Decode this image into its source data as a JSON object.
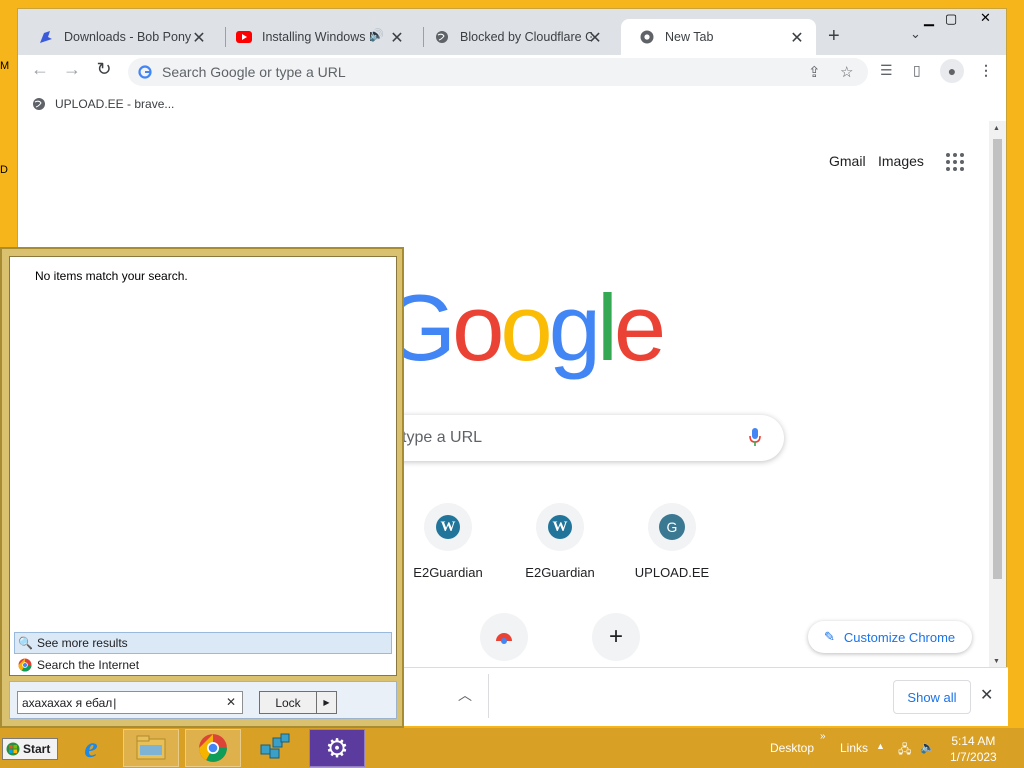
{
  "desktop": {
    "edge_letters": [
      "M",
      "D"
    ]
  },
  "chrome": {
    "tabs": [
      {
        "title": "Downloads - Bob Pony",
        "icon": "bob-pony-favicon-icon"
      },
      {
        "title": "Installing Windows M",
        "icon": "youtube-icon",
        "audio": "speaker-icon"
      },
      {
        "title": "Blocked by Cloudflare Ga",
        "icon": "globe-icon"
      },
      {
        "title": "New Tab",
        "icon": "chrome-icon"
      }
    ],
    "omnibox": {
      "placeholder": "Search Google or type a URL"
    },
    "bookmarks": [
      {
        "label": "UPLOAD.EE - brave..."
      }
    ],
    "ntp": {
      "links": {
        "gmail": "Gmail",
        "images": "Images"
      },
      "logo": "Google",
      "search_placeholder_visible": "type a URL",
      "shortcuts": [
        {
          "label": "E2Guardian",
          "icon": "wordpress-icon"
        },
        {
          "label": "E2Guardian",
          "icon": "wordpress-icon"
        },
        {
          "label": "UPLOAD.EE",
          "icon": "g-avatar-icon",
          "letter": "G"
        }
      ],
      "customize_label": "Customize Chrome"
    },
    "download_bar": {
      "show_all": "Show all"
    }
  },
  "start_menu": {
    "no_items": "No items match your search.",
    "see_more": "See more results",
    "search_internet": "Search the Internet",
    "search_value": "ахахахах я ебал",
    "lock_label": "Lock"
  },
  "taskbar": {
    "start_label": "Start",
    "desktop_label": "Desktop",
    "links_label": "Links",
    "time": "5:14 AM",
    "date": "1/7/2023"
  },
  "colors": {
    "google_blue": "#4285f4",
    "google_red": "#ea4335",
    "google_yellow": "#fbbc05",
    "google_green": "#34a853",
    "desktop_bg": "#f6b61b"
  }
}
